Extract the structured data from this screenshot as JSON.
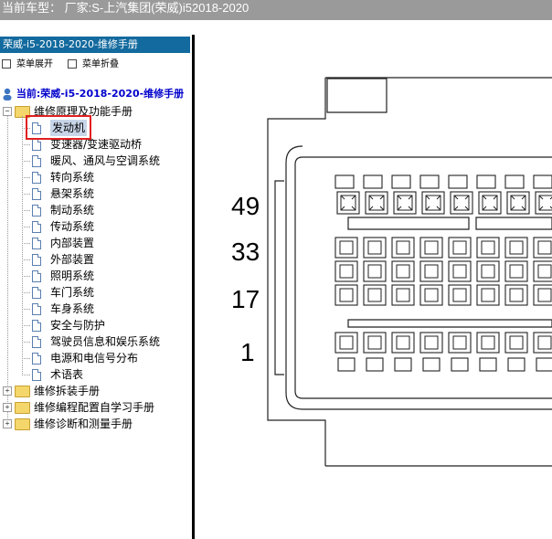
{
  "header": {
    "vehicle": "当前车型：  厂家:S-上汽集团(荣威)i52018-2020"
  },
  "sidebar": {
    "manual_title": "荣威-i5-2018-2020-维修手册",
    "expand_label": "菜单展开",
    "collapse_label": "菜单折叠",
    "current_label": "当前:荣威-i5-2018-2020-维修手册",
    "root": {
      "label": "维修原理及功能手册",
      "expanded": true
    },
    "items": [
      {
        "label": "发动机",
        "selected": true
      },
      {
        "label": "变速器/变速驱动桥"
      },
      {
        "label": "暖风、通风与空调系统"
      },
      {
        "label": "转向系统"
      },
      {
        "label": "悬架系统"
      },
      {
        "label": "制动系统"
      },
      {
        "label": "传动系统"
      },
      {
        "label": "内部装置"
      },
      {
        "label": "外部装置"
      },
      {
        "label": "照明系统"
      },
      {
        "label": "车门系统"
      },
      {
        "label": "车身系统"
      },
      {
        "label": "安全与防护"
      },
      {
        "label": "驾驶员信息和娱乐系统"
      },
      {
        "label": "电源和电信号分布"
      },
      {
        "label": "术语表"
      }
    ],
    "other_roots": [
      {
        "label": "维修拆装手册"
      },
      {
        "label": "维修编程配置自学习手册"
      },
      {
        "label": "维修诊断和测量手册"
      }
    ],
    "highlight_color": "#e02020",
    "title_bg_color": "#136a9e"
  },
  "connector": {
    "pin_labels": [
      "49",
      "33",
      "17",
      "1"
    ]
  }
}
